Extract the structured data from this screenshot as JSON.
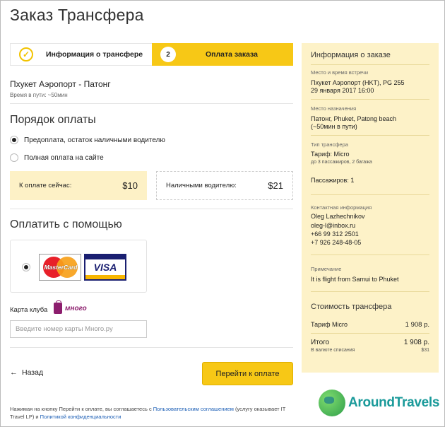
{
  "page_title": "Заказ Трансфера",
  "stepper": {
    "step1_label": "Информация о трансфере",
    "step2_number": "2",
    "step2_label": "Оплата заказа",
    "done_icon": "check-circle-icon"
  },
  "route": "Пхукет Аэропорт - Патонг",
  "travel_time": "Время в пути: ~50мин",
  "payment_order": {
    "title": "Порядок оплаты",
    "options": [
      {
        "label": "Предоплата, остаток наличными водителю",
        "checked": true
      },
      {
        "label": "Полная оплата на сайте",
        "checked": false
      }
    ],
    "pay_now_label": "К оплате сейчас:",
    "pay_now_value": "$10",
    "pay_driver_label": "Наличными водителю:",
    "pay_driver_value": "$21"
  },
  "pay_with": {
    "title": "Оплатить с помощью",
    "mastercard": "MasterCard",
    "visa": "VISA"
  },
  "club": {
    "label": "Карта клуба",
    "logo_text": "много",
    "input_placeholder": "Введите номер карты Много.ру",
    "input_value": ""
  },
  "nav": {
    "back_icon": "arrow-left-icon",
    "back_arrow": "←",
    "back_label": "Назад",
    "submit_label": "Перейти к оплате"
  },
  "footer": {
    "text1": "Нажимая на кнопку Перейти к оплате, вы соглашаетесь с ",
    "link1": "Пользовательским соглашением",
    "text2": " (услугу оказывает IT Travel LP) и ",
    "link2": "Политикой конфиденциальности"
  },
  "sidebar": {
    "title": "Информация о заказе",
    "meeting_label": "Место и время встречи",
    "meeting_place": "Пхукет Аэропорт (HKT), PG 255",
    "meeting_time": "29 января 2017 16:00",
    "destination_label": "Место назначения",
    "destination_line1": "Патонг, Phuket, Patong beach",
    "destination_line2": "(~50мин в пути)",
    "type_label": "Тип трансфера",
    "tariff": "Тариф: Micro",
    "capacity": "до 3 пассажиров, 2 багажа",
    "passengers": "Пассажиров: 1",
    "contact_label": "Контактная информация",
    "contact_name": "Oleg Lazhechnikov",
    "contact_email": "oleg-l@inbox.ru",
    "contact_phone1": "+66 99 312 2501",
    "contact_phone2": "+7 926 248-48-05",
    "note_label": "Примечание",
    "note_text": "It is flight from Samui to Phuket",
    "cost_title": "Стоимость трансфера",
    "cost_tariff_label": "Тариф Micro",
    "cost_tariff_value": "1 908 р.",
    "total_label": "Итого",
    "total_value": "1 908 р.",
    "currency_label": "В валюте списания",
    "currency_value": "$31"
  },
  "watermark": "AroundTravels",
  "colors": {
    "accent": "#f7c816",
    "sidebar_bg": "#fdf2c8",
    "link": "#1a5db5"
  }
}
